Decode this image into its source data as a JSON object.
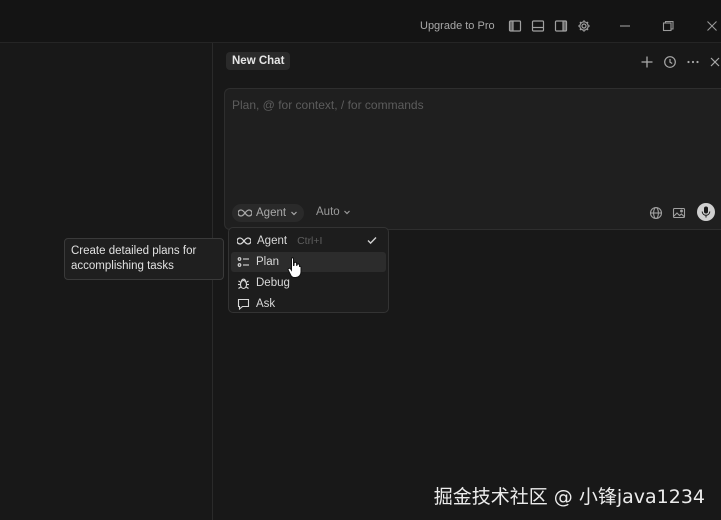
{
  "titlebar": {
    "upgrade_label": "Upgrade to Pro",
    "layout_icons": [
      "sidebar-left-icon",
      "panel-bottom-icon",
      "sidebar-right-icon",
      "gear-icon"
    ],
    "window_controls": [
      "minimize-icon",
      "restore-icon",
      "close-icon"
    ]
  },
  "chat": {
    "tab_label": "New Chat",
    "header_icons": [
      "plus-icon",
      "history-icon",
      "more-icon",
      "close-icon"
    ]
  },
  "composer": {
    "placeholder": "Plan, @ for context, / for commands",
    "value": "",
    "mode_label": "Agent",
    "model_label": "Auto",
    "action_icons": [
      "globe-icon",
      "image-icon",
      "mic-icon"
    ]
  },
  "mode_menu": {
    "items": [
      {
        "label": "Agent",
        "shortcut": "Ctrl+I",
        "icon": "infinity-icon",
        "selected": true
      },
      {
        "label": "Plan",
        "icon": "list-icon",
        "hovered": true
      },
      {
        "label": "Debug",
        "icon": "bug-icon"
      },
      {
        "label": "Ask",
        "icon": "chat-bubble-icon"
      }
    ]
  },
  "tooltip": {
    "text": "Create detailed plans for accomplishing tasks"
  },
  "watermark": "掘金技术社区 @ 小锋java1234",
  "colors": {
    "background": "#181818",
    "panel": "#1f1f1f",
    "text": "#cccccc",
    "muted": "#5c5c5c"
  }
}
